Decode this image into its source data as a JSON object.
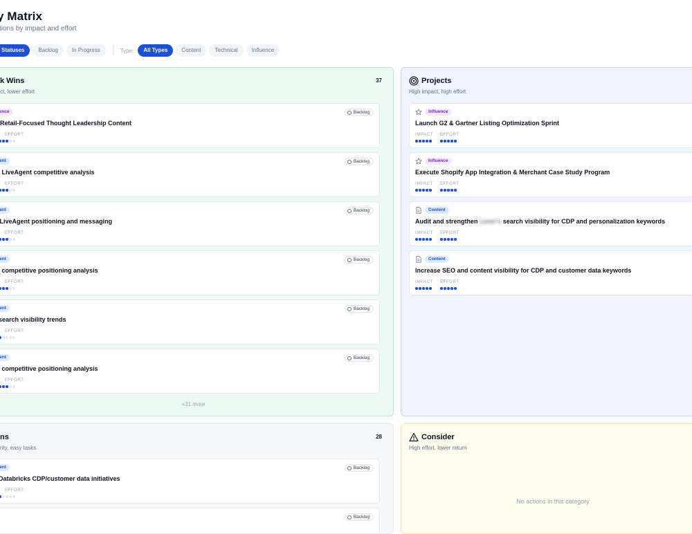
{
  "header": {
    "title": "y Matrix",
    "subtitle": "ctions by impact and effort"
  },
  "filters": {
    "status_chips": [
      "Statuses",
      "Backlog",
      "In Progress"
    ],
    "type_label": "Type:",
    "type_chips": [
      "All Types",
      "Content",
      "Technical",
      "Influence"
    ]
  },
  "labels": {
    "impact": "IMPACT",
    "effort": "EFFORT"
  },
  "quick_wins": {
    "title": "k Wins",
    "subtitle": "ct, lower effort",
    "count": "37",
    "more": "+31 more",
    "cards": [
      {
        "type": "luence",
        "type_kind": "influence",
        "status": "Backlog",
        "title": "p Retail-Focused Thought Leadership Content",
        "effort": 3
      },
      {
        "type": "ntent",
        "type_kind": "content",
        "status": "Backlog",
        "title": "ct LiveAgent competitive analysis",
        "effort": 3
      },
      {
        "type": "ntent",
        "type_kind": "content",
        "status": "Backlog",
        "title": "e LiveAgent positioning and messaging",
        "effort": 3
      },
      {
        "type": "ntent",
        "type_kind": "content",
        "status": "Backlog",
        "title": "ct competitive positioning analysis",
        "effort": 3
      },
      {
        "type": "ntent",
        "type_kind": "content",
        "status": "Backlog",
        "title": "r search visibility trends",
        "effort": 1
      },
      {
        "type": "ntent",
        "type_kind": "content",
        "status": "Backlog",
        "title": "ct competitive positioning analysis",
        "effort": 3
      }
    ]
  },
  "projects": {
    "title": "Projects",
    "subtitle": "High impact, high effort",
    "cards": [
      {
        "icon": "star-icon",
        "type": "Influence",
        "type_kind": "influence",
        "title": "Launch G2 & Gartner Listing Optimization Sprint",
        "impact": 5,
        "effort": 5
      },
      {
        "icon": "star-icon",
        "type": "Influence",
        "type_kind": "influence",
        "title": "Execute Shopify App Integration & Merchant Case Study Program",
        "impact": 5,
        "effort": 5
      },
      {
        "icon": "document-icon",
        "type": "Content",
        "type_kind": "content",
        "title_a": "Audit and strengthen",
        "title_blur": "Lexer's",
        "title_b": "search visibility for CDP and personalization keywords",
        "impact": 5,
        "effort": 5
      },
      {
        "icon": "document-icon",
        "type": "Content",
        "type_kind": "content",
        "title": "Increase SEO and content visibility for CDP and customer data keywords",
        "impact": 5,
        "effort": 5
      }
    ]
  },
  "fill_ins": {
    "title": "ns",
    "subtitle": "rity, easy tasks",
    "count": "28",
    "cards": [
      {
        "type": "ntent",
        "type_kind": "content",
        "status": "Backlog",
        "title": "r Databricks CDP/customer data initiatives",
        "effort": 1
      },
      {
        "type": "",
        "type_kind": "content",
        "status": "Backlog",
        "title": "",
        "effort": 0
      }
    ]
  },
  "consider": {
    "title": "Consider",
    "subtitle": "High effort, lower return",
    "empty": "No actions in this category"
  },
  "colors": {
    "accent": "#1d4ed8",
    "quick_wins_bg": "#ecfaf3",
    "projects_bg": "#eef3fd",
    "consider_bg": "#fefcec"
  }
}
